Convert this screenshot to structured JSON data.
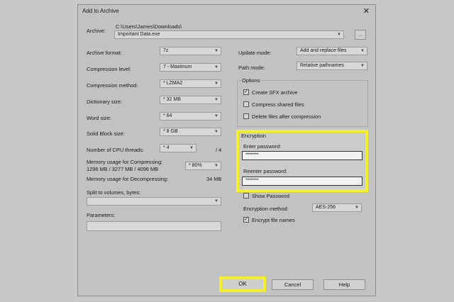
{
  "window": {
    "title": "Add to Archive",
    "close_glyph": "✕"
  },
  "archive": {
    "label": "Archive:",
    "path": "C:\\Users\\James\\Downloads\\",
    "name": "Important Data.exe",
    "browse_label": "..."
  },
  "left": {
    "archive_format": {
      "label": "Archive format:",
      "value": "7z"
    },
    "compression_level": {
      "label": "Compression level:",
      "value": "7 - Maximum"
    },
    "compression_method": {
      "label": "Compression method:",
      "value": "* LZMA2"
    },
    "dictionary_size": {
      "label": "Dictionary size:",
      "value": "* 32 MB"
    },
    "word_size": {
      "label": "Word size:",
      "value": "* 64"
    },
    "solid_block_size": {
      "label": "Solid Block size:",
      "value": "* 8 GB"
    },
    "cpu_threads": {
      "label": "Number of CPU threads:",
      "value": "* 4",
      "max": "/ 4"
    },
    "mem_compress": {
      "label": "Memory usage for Compressing:",
      "detail": "1296 MB / 3277 MB / 4096 MB",
      "value": "* 80%"
    },
    "mem_decompress": {
      "label": "Memory usage for Decompressing:",
      "value": "34 MB"
    },
    "split": {
      "label": "Split to volumes, bytes:",
      "value": ""
    },
    "parameters": {
      "label": "Parameters:",
      "value": ""
    }
  },
  "right": {
    "update_mode": {
      "label": "Update mode:",
      "value": "Add and replace files"
    },
    "path_mode": {
      "label": "Path mode:",
      "value": "Relative pathnames"
    },
    "options": {
      "title": "Options",
      "items": [
        {
          "label": "Create SFX archive",
          "checked": true,
          "mark": "✓"
        },
        {
          "label": "Compress shared files",
          "checked": false,
          "mark": ""
        },
        {
          "label": "Delete files after compression",
          "checked": false,
          "mark": ""
        }
      ]
    },
    "encryption": {
      "title": "Encryption",
      "enter_label": "Enter password:",
      "enter_value": "**********",
      "reenter_label": "Reenter password:",
      "reenter_value": "**********",
      "show_password": {
        "label": "Show Password",
        "mark": ""
      },
      "method": {
        "label": "Encryption method:",
        "value": "AES-256"
      },
      "encrypt_names": {
        "label": "Encrypt file names",
        "mark": "✓"
      }
    }
  },
  "buttons": {
    "ok": "OK",
    "cancel": "Cancel",
    "help": "Help"
  },
  "colors": {
    "highlight": "#f4ee2c",
    "dialog_bg": "#c2c2c2"
  }
}
